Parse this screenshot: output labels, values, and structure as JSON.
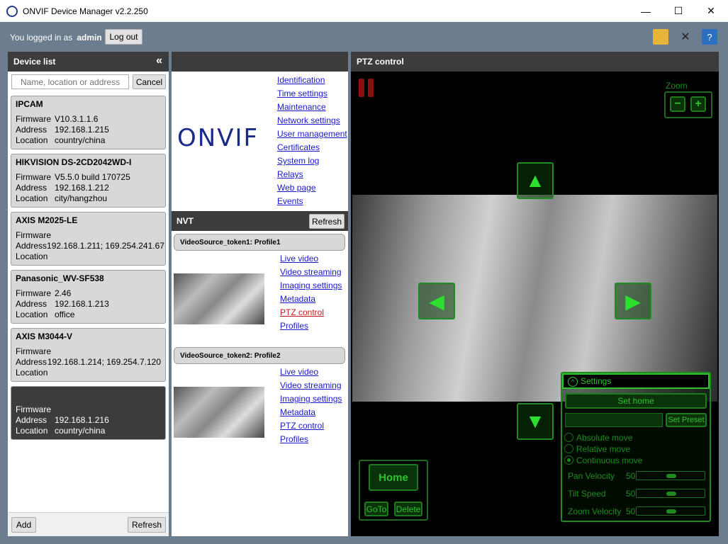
{
  "window": {
    "title": "ONVIF Device Manager v2.2.250",
    "minimize": "—",
    "maximize": "☐",
    "close": "✕"
  },
  "session": {
    "prefix": "You logged in as",
    "user": "admin",
    "logout_label": "Log out"
  },
  "device_list": {
    "title": "Device list",
    "collapse_icon": "«",
    "search_placeholder": "Name, location or address",
    "cancel_label": "Cancel",
    "devices": [
      {
        "name": "IPCAM",
        "firmware": "V10.3.1.1.6",
        "address": "192.168.1.215",
        "location": "country/china"
      },
      {
        "name": "HIKVISION DS-2CD2042WD-I",
        "firmware": "V5.5.0 build 170725",
        "address": "192.168.1.212",
        "location": "city/hangzhou"
      },
      {
        "name": "AXIS M2025-LE",
        "firmware": "",
        "address": "192.168.1.211; 169.254.241.67",
        "location": ""
      },
      {
        "name": "Panasonic_WV-SF538",
        "firmware": "2.46",
        "address": "192.168.1.213",
        "location": "office"
      },
      {
        "name": "AXIS M3044-V",
        "firmware": "",
        "address": "192.168.1.214; 169.254.7.120",
        "location": ""
      },
      {
        "name": "",
        "firmware": "",
        "address": "192.168.1.216",
        "location": "country/china"
      }
    ],
    "field_labels": {
      "firmware": "Firmware",
      "address": "Address",
      "location": "Location"
    },
    "add_label": "Add",
    "refresh_label": "Refresh"
  },
  "device_menu": {
    "logo": "ONVIF",
    "links": [
      "Identification",
      "Time settings",
      "Maintenance",
      "Network settings",
      "User management",
      "Certificates",
      "System log",
      "Relays",
      "Web page",
      "Events"
    ]
  },
  "nvt": {
    "title": "NVT",
    "refresh_label": "Refresh",
    "profiles": [
      {
        "name": "VideoSource_token1: Profile1",
        "links": [
          "Live video",
          "Video streaming",
          "Imaging settings",
          "Metadata",
          "PTZ control",
          "Profiles"
        ],
        "active": "PTZ control"
      },
      {
        "name": "VideoSource_token2: Profile2",
        "links": [
          "Live video",
          "Video streaming",
          "Imaging settings",
          "Metadata",
          "PTZ control",
          "Profiles"
        ],
        "active": ""
      }
    ]
  },
  "ptz": {
    "title": "PTZ control",
    "zoom_label": "Zoom",
    "zoom_out": "−",
    "zoom_in": "+",
    "home_label": "Home",
    "goto_label": "GoTo",
    "delete_label": "Delete",
    "settings": {
      "title": "Settings",
      "set_home_label": "Set home",
      "set_preset_label": "Set Preset",
      "moves": [
        "Absolute move",
        "Relative move",
        "Continuous move"
      ],
      "selected_move": "Continuous move",
      "pan_velocity_label": "Pan Velocity",
      "pan_velocity": "50",
      "tilt_speed_label": "Tilt Speed",
      "tilt_speed": "50",
      "zoom_velocity_label": "Zoom Velocity",
      "zoom_velocity": "50"
    }
  }
}
